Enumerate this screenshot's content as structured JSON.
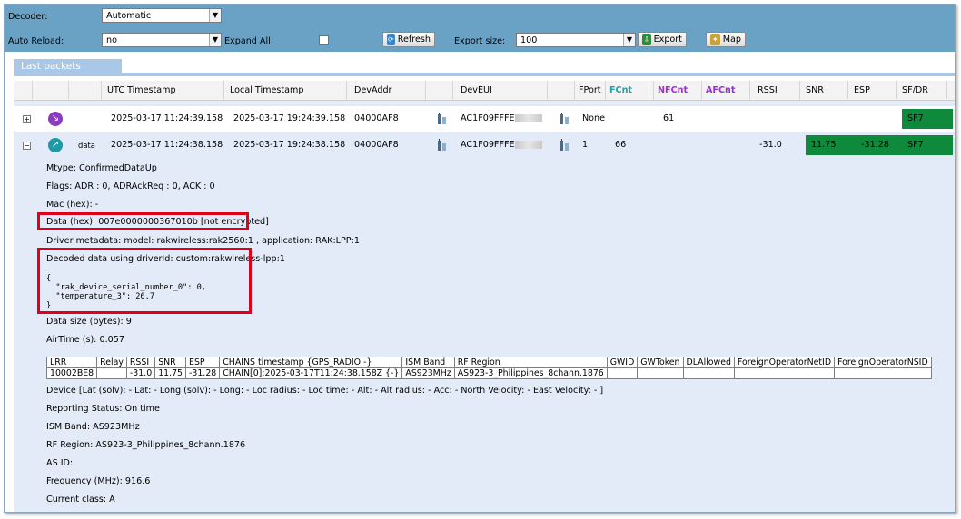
{
  "toolbar": {
    "decoder_label": "Decoder:",
    "decoder_value": "Automatic",
    "auto_reload_label": "Auto Reload:",
    "auto_reload_value": "no",
    "expand_all_label": "Expand All:",
    "refresh_label": "Refresh",
    "export_size_label": "Export size:",
    "export_size_value": "100",
    "export_label": "Export",
    "map_label": "Map"
  },
  "panel_title": "Last packets",
  "columns": [
    "UTC Timestamp",
    "Local Timestamp",
    "DevAddr",
    "DevEUI",
    "FPort",
    "FCnt",
    "NFCnt",
    "AFCnt",
    "RSSI",
    "SNR",
    "ESP",
    "SF/DR"
  ],
  "rows": [
    {
      "expander": "+",
      "type": "",
      "utc": "2025-03-17 11:24:39.158",
      "local": "2025-03-17 19:24:39.158",
      "devaddr": "04000AF8",
      "deveui": "AC1F09FFFE",
      "fport": "None",
      "fcnt": "",
      "nfcnt": "61",
      "afcnt": "",
      "rssi": "",
      "snr": "",
      "esp": "",
      "sf": "SF7"
    },
    {
      "expander": "−",
      "type": "data",
      "utc": "2025-03-17 11:24:38.158",
      "local": "2025-03-17 19:24:38.158",
      "devaddr": "04000AF8",
      "deveui": "AC1F09FFFE",
      "fport": "1",
      "fcnt": "66",
      "nfcnt": "",
      "afcnt": "",
      "rssi": "-31.0",
      "snr": "11.75",
      "esp": "-31.28",
      "sf": "SF7"
    }
  ],
  "details": {
    "mtype": "Mtype: ConfirmedDataUp",
    "flags": "Flags: ADR : 0, ADRAckReq : 0, ACK : 0",
    "mac": "Mac (hex): -",
    "data_hex": "Data (hex): 007e0000000367010b [not encrypted]",
    "driver_meta": "Driver metadata: model: rakwireless:rak2560:1 , application: RAK:LPP:1",
    "decoded_title": "Decoded data using driverId: custom:rakwireless-lpp:1",
    "decoded_json": "{\n  \"rak_device_serial_number_0\": 0,\n  \"temperature_3\": 26.7\n}",
    "data_size": "Data size (bytes): 9",
    "airtime": "AirTime (s): 0.057",
    "device": "Device [Lat (solv): - Lat: - Long (solv): - Long: - Loc radius: - Loc time: - Alt: - Alt radius: - Acc: - North Velocity: - East Velocity: - ]",
    "reporting": "Reporting Status: On time",
    "ism_band": "ISM Band: AS923MHz",
    "rf_region": "RF Region: AS923-3_Philippines_8chann.1876",
    "as_id": "AS ID:",
    "frequency": "Frequency (MHz): 916.6",
    "current_class": "Current class: A"
  },
  "lrr_table": {
    "headers": [
      "LRR",
      "Relay",
      "RSSI",
      "SNR",
      "ESP",
      "CHAINS timestamp {GPS_RADIO|-}",
      "ISM Band",
      "RF Region",
      "GWID",
      "GWToken",
      "DLAllowed",
      "ForeignOperatorNetID",
      "ForeignOperatorNSID"
    ],
    "row": [
      "10002BE8",
      "",
      "-31.0",
      "11.75",
      "-31.28",
      "CHAIN[0]:2025-03-17T11:24:38.158Z {-}",
      "AS923MHz",
      "AS923-3_Philippines_8chann.1876",
      "",
      "",
      "",
      "",
      ""
    ]
  },
  "colors": {
    "toolbar_bg": "#6aa2c6",
    "grid_bg": "#e2ebf7",
    "good_signal": "#0f8a3c",
    "highlight": "#e0001a",
    "fcnt_header": "#1fa3a3",
    "nfcnt_header": "#9b30d0"
  }
}
